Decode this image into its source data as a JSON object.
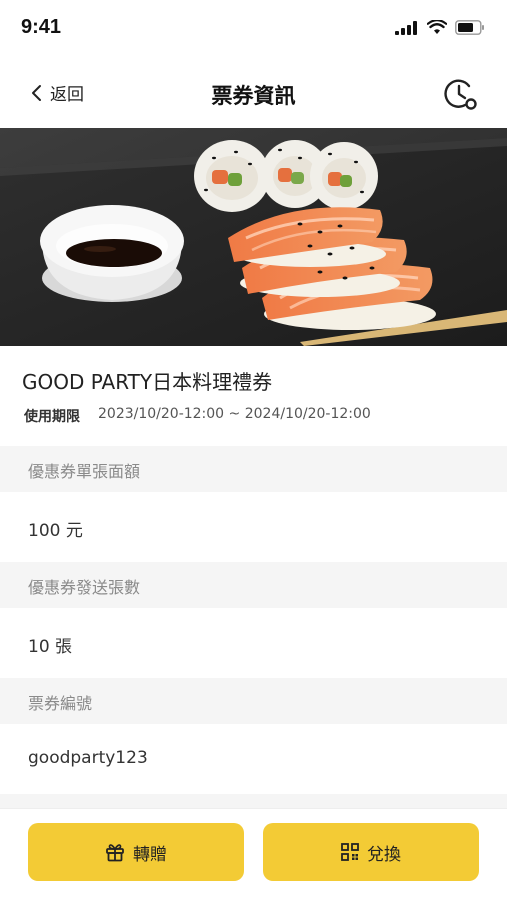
{
  "status_bar": {
    "time": "9:41"
  },
  "nav": {
    "back_label": "返回",
    "title": "票券資訊"
  },
  "coupon": {
    "name": "GOOD PARTY日本料理禮券",
    "validity_label": "使用期限",
    "validity_value": "2023/10/20-12:00 ~ 2024/10/20-12:00"
  },
  "details": [
    {
      "label": "優惠券單張面額",
      "value": "100 元"
    },
    {
      "label": "優惠券發送張數",
      "value": "10 張"
    },
    {
      "label": "票券編號",
      "value": "goodparty123"
    }
  ],
  "actions": {
    "gift_label": "轉贈",
    "redeem_label": "兌換"
  },
  "colors": {
    "accent": "#f3cb35",
    "section_bg": "#f5f5f5"
  },
  "icons": [
    "signal-icon",
    "wifi-icon",
    "battery-icon",
    "chevron-left-icon",
    "history-clock-icon",
    "gift-icon",
    "qr-code-icon"
  ]
}
